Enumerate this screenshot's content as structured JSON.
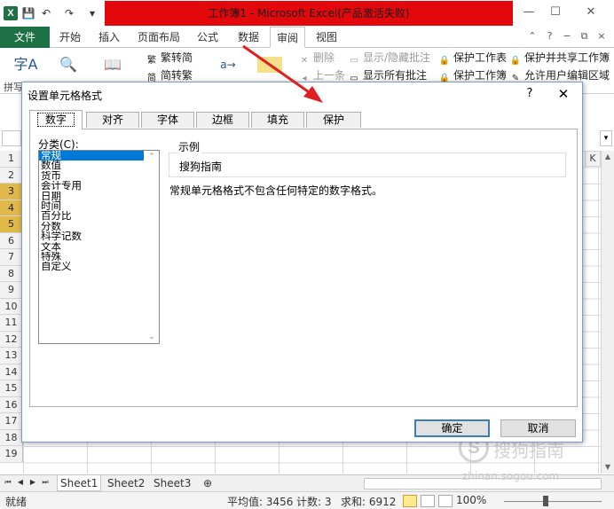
{
  "window": {
    "title": "工作簿1 - Microsoft Excel(产品激活失败)",
    "min": "—",
    "max": "☐",
    "close": "✕",
    "qat": [
      "💾",
      "↶",
      "↷",
      "▾"
    ]
  },
  "ribbon_tabs": [
    "文件",
    "开始",
    "插入",
    "页面布局",
    "公式",
    "数据",
    "审阅",
    "视图"
  ],
  "active_ribbon_tab": "审阅",
  "ribbon": {
    "proof": "字A",
    "group_label": "拼写",
    "trad_to_simp": "繁转简",
    "simp_to_trad": "简转繁",
    "delete": "删除",
    "prev": "上一条",
    "show_hide_comment": "显示/隐藏批注",
    "show_all_comments": "显示所有批注",
    "protect_sheet": "保护工作表",
    "protect_book": "保护工作簿",
    "protect_share": "保护并共享工作簿",
    "allow_edit": "允许用户编辑区域"
  },
  "sheet": {
    "rows": [
      "1",
      "2",
      "3",
      "4",
      "5",
      "6",
      "7",
      "8",
      "9",
      "10",
      "11",
      "12",
      "13",
      "14",
      "15",
      "16",
      "17",
      "18",
      "19"
    ],
    "selected_rows": [
      "3",
      "4",
      "5"
    ],
    "col_k": "K",
    "tabs": [
      "Sheet1",
      "Sheet2",
      "Sheet3"
    ],
    "active_tab": "Sheet1"
  },
  "status": {
    "ready": "就绪",
    "average": "平均值: 3456",
    "count": "计数: 3",
    "sum": "求和: 6912",
    "zoom": "100%"
  },
  "watermark": {
    "logo": "S",
    "text": "搜狗指南",
    "url": "zhinan.sogou.com"
  },
  "dialog": {
    "title": "设置单元格格式",
    "help": "?",
    "close": "✕",
    "tabs": [
      "数字",
      "对齐",
      "字体",
      "边框",
      "填充",
      "保护"
    ],
    "active_tab": "数字",
    "category_label": "分类(C):",
    "categories": [
      "常规",
      "数值",
      "货币",
      "会计专用",
      "日期",
      "时间",
      "百分比",
      "分数",
      "科学记数",
      "文本",
      "特殊",
      "自定义"
    ],
    "selected_category": "常规",
    "sample_label": "示例",
    "sample_value": "搜狗指南",
    "description": "常规单元格格式不包含任何特定的数字格式。",
    "ok": "确定",
    "cancel": "取消"
  },
  "colors": {
    "excel_green": "#1e7145",
    "title_highlight": "#e3080b",
    "selection_blue": "#0078d7",
    "arrow_red": "#e02020",
    "row_selected": "#e1b94a"
  }
}
